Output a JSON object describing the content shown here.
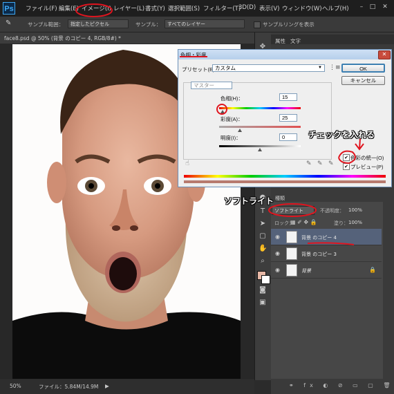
{
  "menubar": {
    "logo": "Ps",
    "items": [
      "ファイル(F)",
      "編集(E)",
      "イメージ(I)",
      "レイヤー(L)",
      "書式(Y)",
      "選択範囲(S)",
      "フィルター(T)",
      "3D(D)",
      "表示(V)",
      "ウィンドウ(W)",
      "ヘルプ(H)"
    ]
  },
  "options": {
    "sample_label": "サンプル範囲：",
    "sample_value": "指定したピクセル",
    "sample2_label": "サンプル：",
    "sample2_value": "すべてのレイヤー",
    "ring_label": "サンプルリングを表示"
  },
  "document": {
    "tab": "face8.psd @ 50% (背景 のコピー 4, RGB/8#) *",
    "zoom": "50%",
    "file_info": "ファイル：5.84M/14.9M"
  },
  "panels": {
    "tab1": "属性",
    "tab2": "文字"
  },
  "dialog": {
    "title": "色相・彩度",
    "preset_label": "プリセット(E)：",
    "preset_value": "カスタム",
    "ok": "OK",
    "cancel": "キャンセル",
    "channel": "マスター",
    "hue_label": "色相(H)：",
    "hue_value": "15",
    "sat_label": "彩度(A)：",
    "sat_value": "25",
    "light_label": "明度(I)：",
    "light_value": "0",
    "colorize_label": "色彩の統一(O)",
    "preview_label": "プレビュー(P)",
    "colorize_checked": true,
    "preview_checked": true
  },
  "layers": {
    "tab": "種類",
    "blend_mode": "ソフトライト",
    "opacity_label": "不透明度：",
    "opacity_value": "100%",
    "lock_label": "ロック：",
    "fill_label": "塗り：",
    "fill_value": "100%",
    "items": [
      {
        "name": "背景 のコピー 4",
        "selected": true
      },
      {
        "name": "背景 のコピー 3",
        "selected": false
      },
      {
        "name": "背景",
        "selected": false
      }
    ]
  },
  "annotations": {
    "check": "チェックを入れる",
    "blend": "ソフトライト"
  },
  "colors": {
    "annotation_red": "#e0141e",
    "selected_layer": "#55627a",
    "app_dark": "#2b2b2b"
  }
}
